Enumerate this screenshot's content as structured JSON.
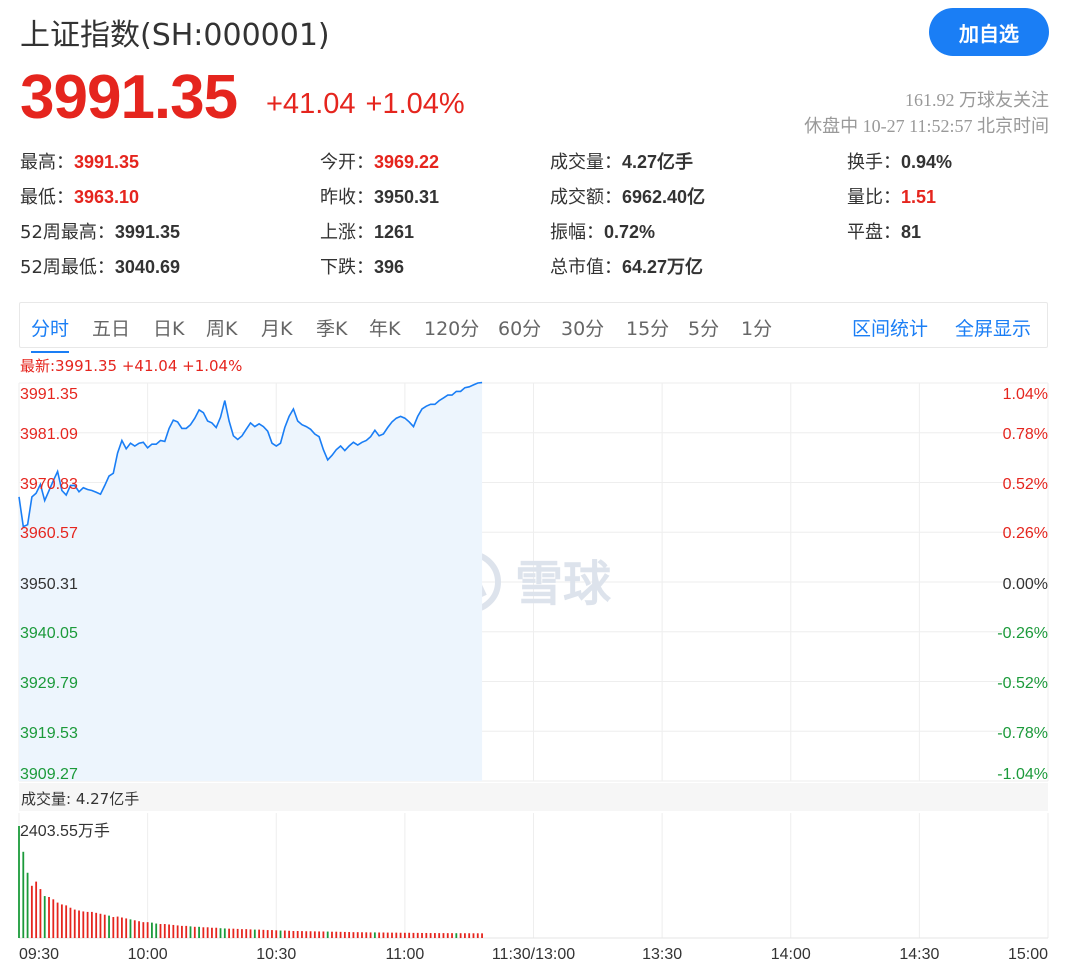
{
  "header": {
    "title": "上证指数(SH:000001)",
    "add_button": "加自选",
    "price": "3991.35",
    "change": "+41.04",
    "change_pct": "+1.04%",
    "followers": "161.92 万球友关注",
    "status": "休盘中 10-27 11:52:57 北京时间"
  },
  "stats": [
    {
      "label": "最高：",
      "value": "3991.35",
      "color": "red"
    },
    {
      "label": "今开：",
      "value": "3969.22",
      "color": "red"
    },
    {
      "label": "成交量：",
      "value": "4.27亿手",
      "color": "dark"
    },
    {
      "label": "换手：",
      "value": "0.94%",
      "color": "dark"
    },
    {
      "label": "最低：",
      "value": "3963.10",
      "color": "red"
    },
    {
      "label": "昨收：",
      "value": "3950.31",
      "color": "dark"
    },
    {
      "label": "成交额：",
      "value": "6962.40亿",
      "color": "dark"
    },
    {
      "label": "量比：",
      "value": "1.51",
      "color": "red"
    },
    {
      "label": "52周最高：",
      "value": "3991.35",
      "color": "dark"
    },
    {
      "label": "上涨：",
      "value": "1261",
      "color": "dark"
    },
    {
      "label": "振幅：",
      "value": "0.72%",
      "color": "dark"
    },
    {
      "label": "平盘：",
      "value": "81",
      "color": "dark"
    },
    {
      "label": "52周最低：",
      "value": "3040.69",
      "color": "dark"
    },
    {
      "label": "下跌：",
      "value": "396",
      "color": "dark"
    },
    {
      "label": "总市值：",
      "value": "64.27万亿",
      "color": "dark"
    }
  ],
  "tabs": [
    "分时",
    "五日",
    "日K",
    "周K",
    "月K",
    "季K",
    "年K",
    "120分",
    "60分",
    "30分",
    "15分",
    "5分",
    "1分"
  ],
  "active_tab": 0,
  "tab_links": [
    "区间统计",
    "全屏显示"
  ],
  "chart_latest": "最新:3991.35 +41.04 +1.04%",
  "watermark": "雪球",
  "volume_label": "成交量: 4.27亿手",
  "colors": {
    "up": "#e5251e",
    "down": "#1b9a3a",
    "line": "#1a7ef5",
    "accent": "#1a7ef5"
  },
  "chart_data": {
    "type": "line",
    "price_axis_labels": [
      "3991.35",
      "3981.09",
      "3970.83",
      "3960.57",
      "3950.31",
      "3940.05",
      "3929.79",
      "3919.53",
      "3909.27"
    ],
    "pct_axis_labels": [
      "1.04%",
      "0.78%",
      "0.52%",
      "0.26%",
      "0.00%",
      "-0.26%",
      "-0.52%",
      "-0.78%",
      "-1.04%"
    ],
    "ylim": [
      3909.27,
      3991.35
    ],
    "base": 3950.31,
    "time_labels": [
      "09:30",
      "10:00",
      "10:30",
      "11:00",
      "11:30/13:00",
      "13:30",
      "14:00",
      "14:30",
      "15:00"
    ],
    "total_minutes": 240,
    "price_series": [
      [
        0,
        3968.9
      ],
      [
        1,
        3962.5
      ],
      [
        2,
        3962.9
      ],
      [
        3,
        3968.9
      ],
      [
        4,
        3969.7
      ],
      [
        5,
        3971.6
      ],
      [
        6,
        3968.1
      ],
      [
        8,
        3972.4
      ],
      [
        9,
        3974.4
      ],
      [
        10,
        3970.3
      ],
      [
        11,
        3969.3
      ],
      [
        12,
        3971.4
      ],
      [
        13,
        3971.4
      ],
      [
        14,
        3970.0
      ],
      [
        15,
        3970.9
      ],
      [
        16,
        3970.5
      ],
      [
        17,
        3970.3
      ],
      [
        18,
        3969.9
      ],
      [
        19,
        3969.5
      ],
      [
        20,
        3971.4
      ],
      [
        21,
        3973.4
      ],
      [
        22,
        3974.0
      ],
      [
        23,
        3978.4
      ],
      [
        24,
        3981.1
      ],
      [
        25,
        3979.3
      ],
      [
        26,
        3980.5
      ],
      [
        27,
        3979.9
      ],
      [
        28,
        3980.5
      ],
      [
        29,
        3980.7
      ],
      [
        30,
        3979.5
      ],
      [
        31,
        3980.3
      ],
      [
        32,
        3980.3
      ],
      [
        33,
        3981.1
      ],
      [
        34,
        3980.9
      ],
      [
        35,
        3983.7
      ],
      [
        36,
        3985.5
      ],
      [
        37,
        3985.1
      ],
      [
        38,
        3983.7
      ],
      [
        39,
        3983.7
      ],
      [
        40,
        3984.5
      ],
      [
        41,
        3985.9
      ],
      [
        42,
        3987.7
      ],
      [
        43,
        3987.1
      ],
      [
        44,
        3985.3
      ],
      [
        45,
        3984.9
      ],
      [
        46,
        3983.9
      ],
      [
        47,
        3986.1
      ],
      [
        48,
        3989.7
      ],
      [
        49,
        3985.3
      ],
      [
        50,
        3982.1
      ],
      [
        51,
        3981.3
      ],
      [
        52,
        3982.1
      ],
      [
        53,
        3983.5
      ],
      [
        54,
        3984.9
      ],
      [
        55,
        3984.1
      ],
      [
        56,
        3984.7
      ],
      [
        57,
        3984.1
      ],
      [
        58,
        3983.1
      ],
      [
        59,
        3980.5
      ],
      [
        60,
        3979.9
      ],
      [
        61,
        3980.5
      ],
      [
        62,
        3983.9
      ],
      [
        63,
        3986.3
      ],
      [
        64,
        3987.9
      ],
      [
        65,
        3985.3
      ],
      [
        66,
        3984.5
      ],
      [
        67,
        3984.1
      ],
      [
        68,
        3983.5
      ],
      [
        69,
        3982.5
      ],
      [
        70,
        3981.9
      ],
      [
        71,
        3979.1
      ],
      [
        72,
        3976.9
      ],
      [
        73,
        3977.9
      ],
      [
        74,
        3979.1
      ],
      [
        75,
        3979.9
      ],
      [
        76,
        3978.9
      ],
      [
        77,
        3979.9
      ],
      [
        78,
        3980.7
      ],
      [
        79,
        3980.1
      ],
      [
        80,
        3980.7
      ],
      [
        81,
        3981.1
      ],
      [
        82,
        3981.9
      ],
      [
        83,
        3983.3
      ],
      [
        84,
        3982.1
      ],
      [
        85,
        3982.5
      ],
      [
        86,
        3983.9
      ],
      [
        87,
        3985.1
      ],
      [
        88,
        3985.9
      ],
      [
        89,
        3986.3
      ],
      [
        90,
        3985.9
      ],
      [
        91,
        3985.1
      ],
      [
        92,
        3984.1
      ],
      [
        93,
        3986.3
      ],
      [
        94,
        3987.9
      ],
      [
        95,
        3988.5
      ],
      [
        96,
        3988.9
      ],
      [
        97,
        3988.9
      ],
      [
        98,
        3989.7
      ],
      [
        99,
        3990.3
      ],
      [
        100,
        3990.9
      ],
      [
        101,
        3990.9
      ],
      [
        102,
        3991.7
      ],
      [
        103,
        3991.7
      ],
      [
        104,
        3992.5
      ],
      [
        105,
        3992.7
      ],
      [
        106,
        3993.1
      ],
      [
        107,
        3993.5
      ],
      [
        108,
        3993.6
      ]
    ],
    "volume_max_label": "2403.55万手",
    "volume_max": 2403.55,
    "volume_series": [
      [
        0,
        2403.55,
        "down"
      ],
      [
        1,
        1850,
        "down"
      ],
      [
        2,
        1400,
        "down"
      ],
      [
        3,
        1120,
        "up"
      ],
      [
        4,
        1210,
        "up"
      ],
      [
        5,
        1050,
        "up"
      ],
      [
        6,
        900,
        "down"
      ],
      [
        7,
        880,
        "up"
      ],
      [
        8,
        830,
        "up"
      ],
      [
        9,
        760,
        "up"
      ],
      [
        10,
        720,
        "up"
      ],
      [
        11,
        700,
        "up"
      ],
      [
        12,
        650,
        "up"
      ],
      [
        13,
        610,
        "up"
      ],
      [
        14,
        590,
        "up"
      ],
      [
        15,
        570,
        "up"
      ],
      [
        16,
        560,
        "up"
      ],
      [
        17,
        560,
        "up"
      ],
      [
        18,
        540,
        "up"
      ],
      [
        19,
        520,
        "up"
      ],
      [
        20,
        500,
        "up"
      ],
      [
        21,
        480,
        "down"
      ],
      [
        22,
        450,
        "up"
      ],
      [
        23,
        460,
        "up"
      ],
      [
        24,
        440,
        "up"
      ],
      [
        25,
        420,
        "up"
      ],
      [
        26,
        400,
        "down"
      ],
      [
        27,
        380,
        "up"
      ],
      [
        28,
        360,
        "up"
      ],
      [
        29,
        340,
        "up"
      ],
      [
        30,
        340,
        "up"
      ],
      [
        31,
        330,
        "down"
      ],
      [
        32,
        310,
        "down"
      ],
      [
        33,
        300,
        "up"
      ],
      [
        34,
        300,
        "up"
      ],
      [
        35,
        290,
        "up"
      ],
      [
        36,
        280,
        "up"
      ],
      [
        37,
        270,
        "up"
      ],
      [
        38,
        260,
        "up"
      ],
      [
        39,
        260,
        "up"
      ],
      [
        40,
        250,
        "down"
      ],
      [
        41,
        240,
        "up"
      ],
      [
        42,
        240,
        "down"
      ],
      [
        43,
        230,
        "up"
      ],
      [
        44,
        230,
        "up"
      ],
      [
        45,
        220,
        "up"
      ],
      [
        46,
        220,
        "up"
      ],
      [
        47,
        210,
        "down"
      ],
      [
        48,
        205,
        "down"
      ],
      [
        49,
        200,
        "up"
      ],
      [
        50,
        200,
        "up"
      ],
      [
        51,
        195,
        "up"
      ],
      [
        52,
        190,
        "up"
      ],
      [
        53,
        190,
        "up"
      ],
      [
        54,
        185,
        "up"
      ],
      [
        55,
        180,
        "down"
      ],
      [
        56,
        180,
        "up"
      ],
      [
        57,
        175,
        "up"
      ],
      [
        58,
        170,
        "up"
      ],
      [
        59,
        170,
        "up"
      ],
      [
        60,
        165,
        "up"
      ],
      [
        61,
        160,
        "down"
      ],
      [
        62,
        160,
        "up"
      ],
      [
        63,
        155,
        "up"
      ],
      [
        64,
        150,
        "up"
      ],
      [
        65,
        150,
        "up"
      ],
      [
        66,
        148,
        "up"
      ],
      [
        67,
        145,
        "up"
      ],
      [
        68,
        145,
        "up"
      ],
      [
        69,
        142,
        "up"
      ],
      [
        70,
        140,
        "up"
      ],
      [
        71,
        140,
        "up"
      ],
      [
        72,
        138,
        "down"
      ],
      [
        73,
        135,
        "up"
      ],
      [
        74,
        135,
        "up"
      ],
      [
        75,
        132,
        "up"
      ],
      [
        76,
        130,
        "up"
      ],
      [
        77,
        128,
        "up"
      ],
      [
        78,
        125,
        "up"
      ],
      [
        79,
        125,
        "up"
      ],
      [
        80,
        123,
        "up"
      ],
      [
        81,
        122,
        "up"
      ],
      [
        82,
        120,
        "up"
      ],
      [
        83,
        120,
        "down"
      ],
      [
        84,
        118,
        "up"
      ],
      [
        85,
        118,
        "up"
      ],
      [
        86,
        116,
        "up"
      ],
      [
        87,
        115,
        "up"
      ],
      [
        88,
        115,
        "up"
      ],
      [
        89,
        113,
        "up"
      ],
      [
        90,
        112,
        "up"
      ],
      [
        91,
        112,
        "up"
      ],
      [
        92,
        110,
        "up"
      ],
      [
        93,
        110,
        "up"
      ],
      [
        94,
        108,
        "up"
      ],
      [
        95,
        108,
        "up"
      ],
      [
        96,
        106,
        "up"
      ],
      [
        97,
        106,
        "up"
      ],
      [
        98,
        105,
        "up"
      ],
      [
        99,
        105,
        "up"
      ],
      [
        100,
        104,
        "up"
      ],
      [
        101,
        104,
        "up"
      ],
      [
        102,
        103,
        "down"
      ],
      [
        103,
        103,
        "up"
      ],
      [
        104,
        102,
        "up"
      ],
      [
        105,
        102,
        "up"
      ],
      [
        106,
        101,
        "up"
      ],
      [
        107,
        101,
        "up"
      ],
      [
        108,
        100,
        "up"
      ]
    ]
  }
}
